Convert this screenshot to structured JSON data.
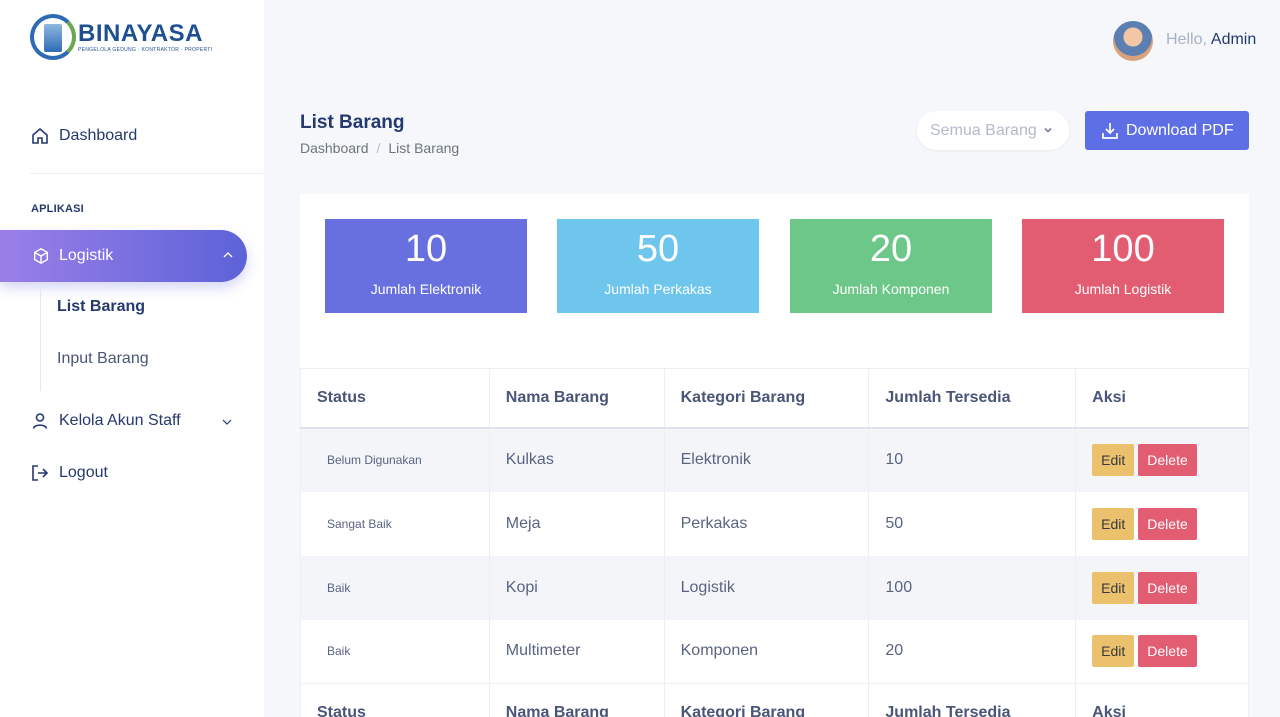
{
  "brand": {
    "name": "BINAYASA",
    "tagline": "PENGELOLA GEDUNG · KONTRAKTOR · PROPERTI"
  },
  "sidebar": {
    "dashboard_label": "Dashboard",
    "section_title": "APLIKASI",
    "logistik_label": "Logistik",
    "submenu": [
      {
        "label": "List Barang",
        "active": true
      },
      {
        "label": "Input Barang",
        "active": false
      }
    ],
    "staff_label": "Kelola Akun Staff",
    "logout_label": "Logout"
  },
  "header": {
    "greeting": "Hello,",
    "user": "Admin"
  },
  "page": {
    "title": "List Barang",
    "breadcrumb": [
      "Dashboard",
      "List Barang"
    ],
    "breadcrumb_sep": "/",
    "filter_value": "Semua Barang",
    "download_label": "Download PDF"
  },
  "stats": [
    {
      "value": "10",
      "label": "Jumlah Elektronik",
      "color": "#6770de"
    },
    {
      "value": "50",
      "label": "Jumlah Perkakas",
      "color": "#6ec6ec"
    },
    {
      "value": "20",
      "label": "Jumlah Komponen",
      "color": "#6cc788"
    },
    {
      "value": "100",
      "label": "Jumlah Logistik",
      "color": "#e35d72"
    }
  ],
  "table": {
    "columns": [
      "Status",
      "Nama Barang",
      "Kategori Barang",
      "Jumlah Tersedia",
      "Aksi"
    ],
    "rows": [
      {
        "status": "Belum Digunakan",
        "nama": "Kulkas",
        "kategori": "Elektronik",
        "jumlah": "10"
      },
      {
        "status": "Sangat Baik",
        "nama": "Meja",
        "kategori": "Perkakas",
        "jumlah": "50"
      },
      {
        "status": "Baik",
        "nama": "Kopi",
        "kategori": "Logistik",
        "jumlah": "100"
      },
      {
        "status": "Baik",
        "nama": "Multimeter",
        "kategori": "Komponen",
        "jumlah": "20"
      }
    ],
    "edit_label": "Edit",
    "delete_label": "Delete"
  },
  "colors": {
    "accent": "#5e6ee4",
    "edit": "#ecc16e",
    "delete": "#e35d72"
  }
}
